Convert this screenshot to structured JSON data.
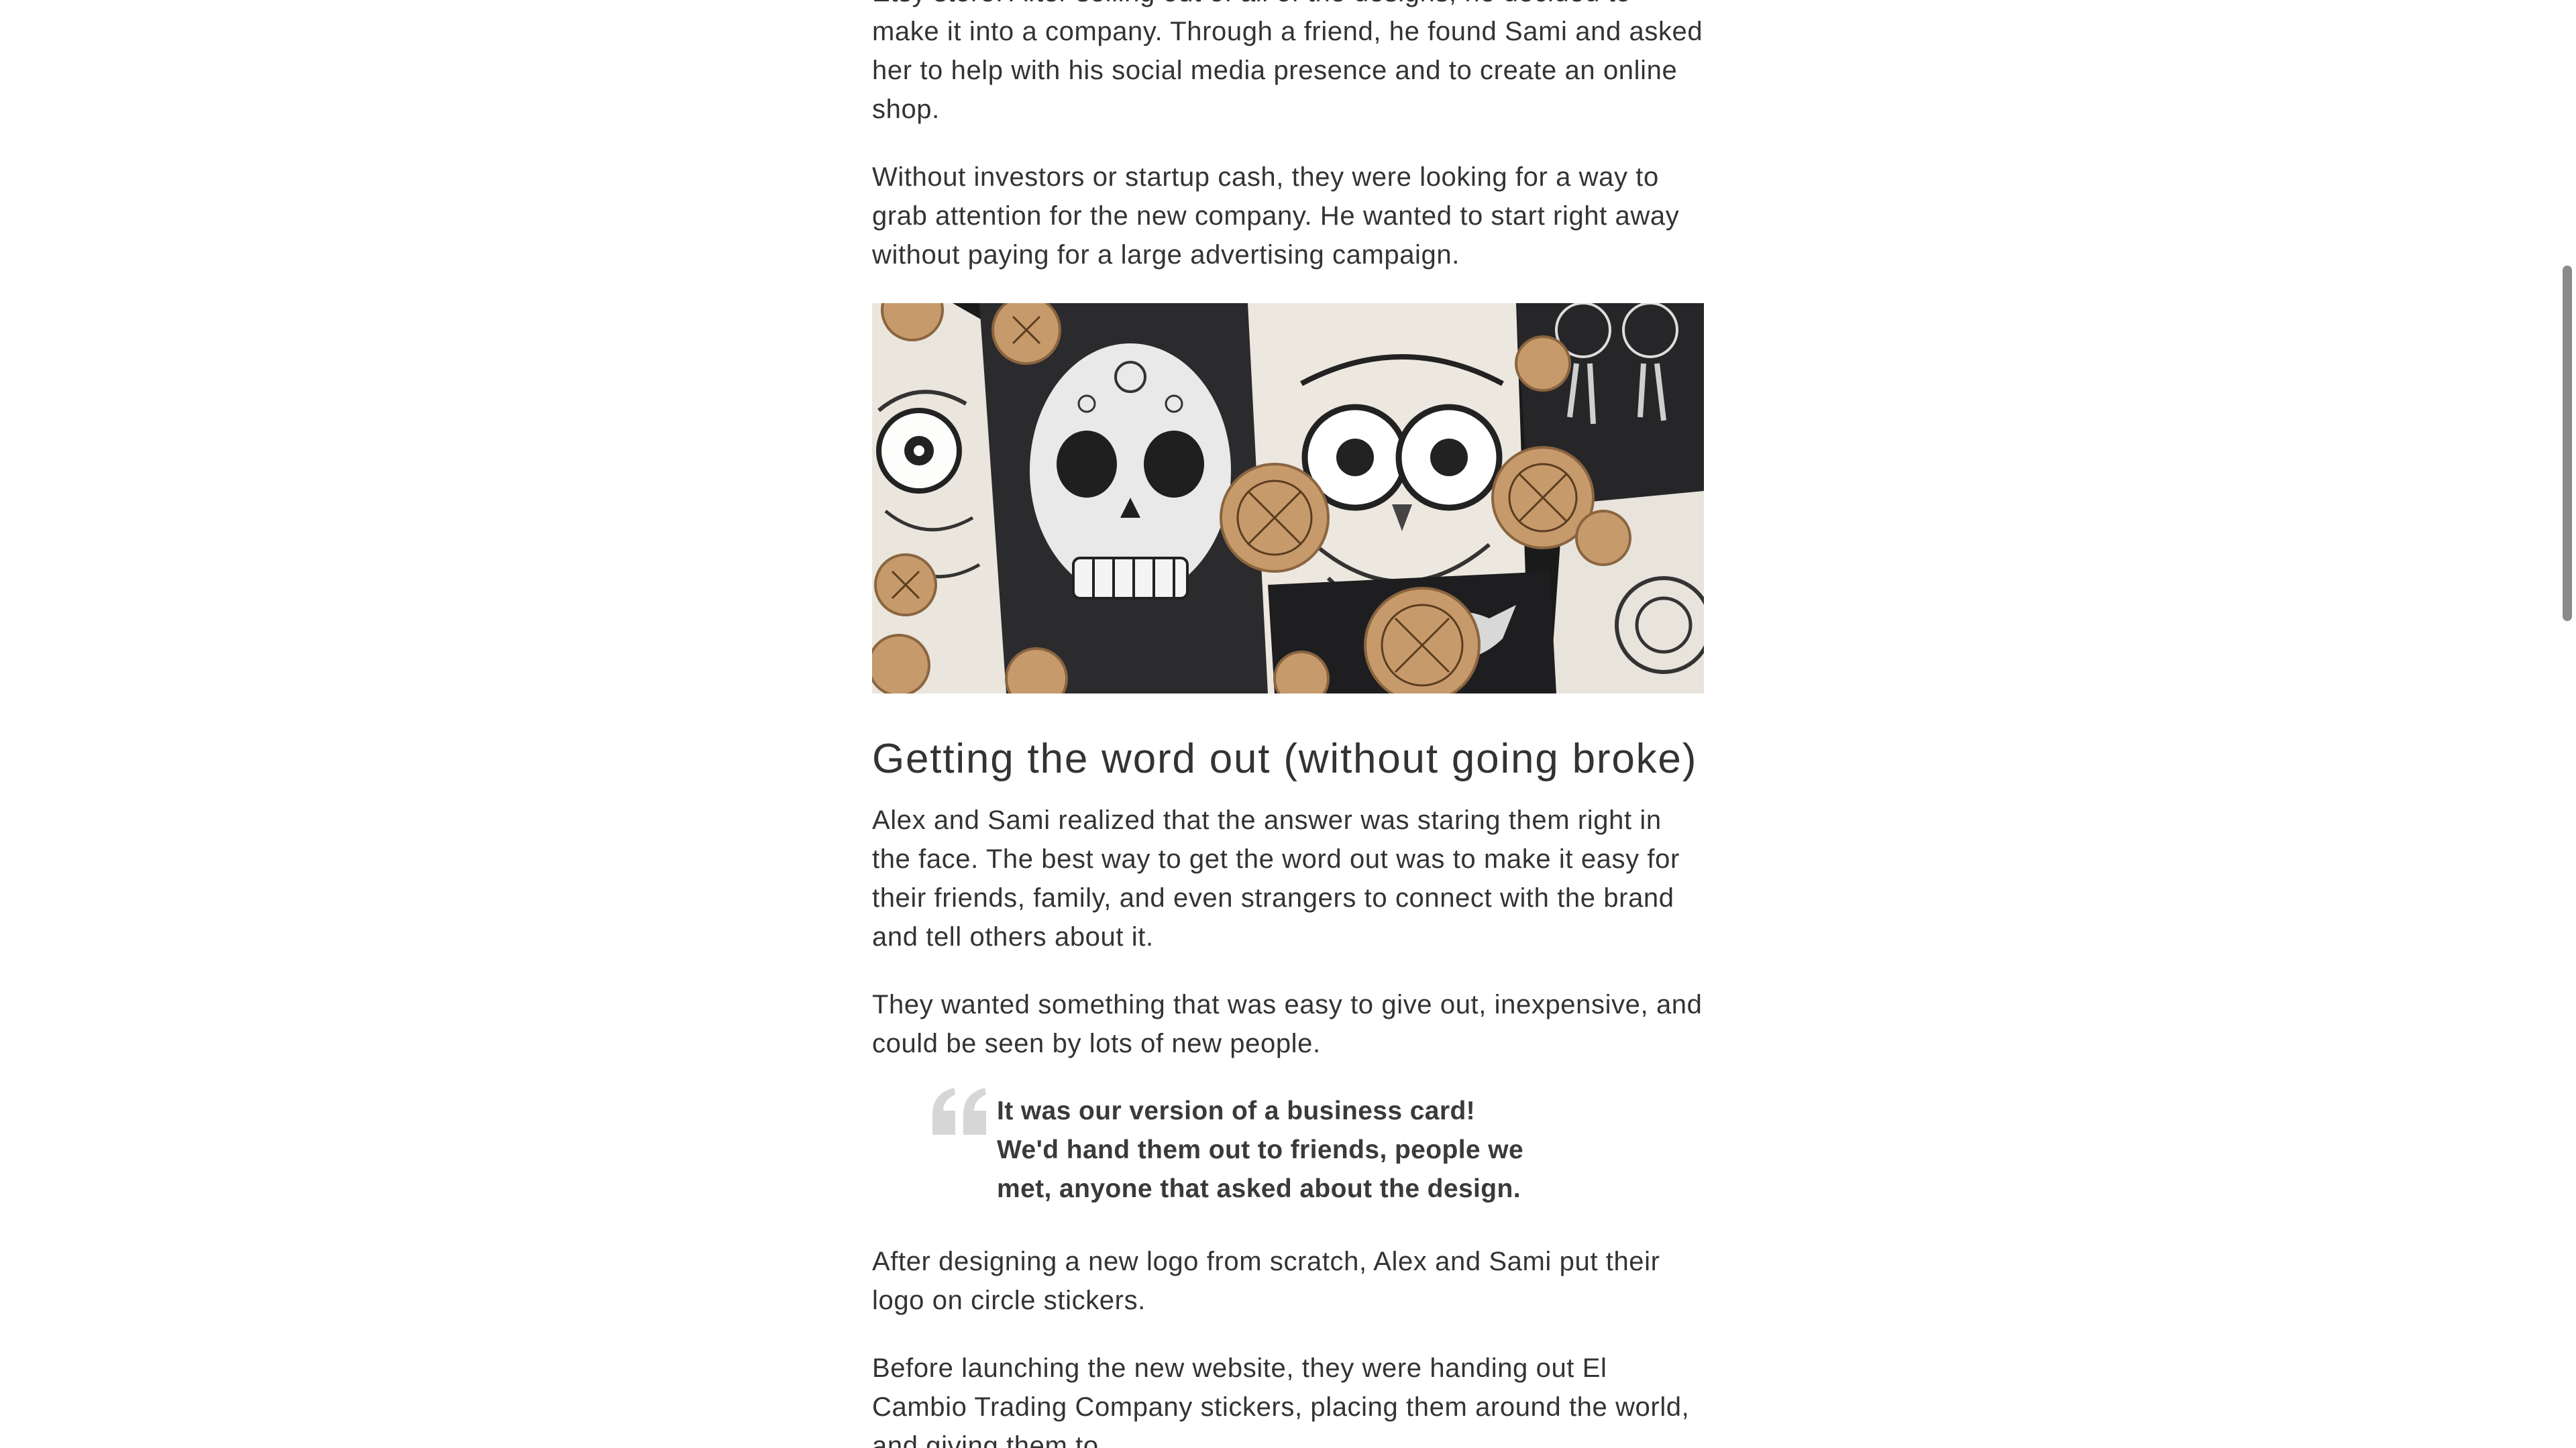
{
  "article": {
    "paragraphs_top": [
      "Alex began selling his hand-drawn designs and tanks through an Etsy store. After selling out of all of the designs, he decided to make it into a company. Through a friend, he found Sami and asked her to help with his social media presence and to create an online shop.",
      "Without investors or startup cash, they were looking for a way to grab attention for the new company. He wanted to start right away without paying for a large advertising campaign."
    ],
    "heading": "Getting the word out (without going broke)",
    "paragraphs_middle": [
      "Alex and Sami realized that the answer was staring them right in the face. The best way to get the word out was to make it easy for their friends, family, and even strangers to connect with the brand and tell others about it.",
      "They wanted something that was easy to give out, inexpensive, and could be seen by lots of new people."
    ],
    "quote": "It was our version of a business card! We'd hand them out to friends, people we met, anyone that asked about the design.",
    "paragraphs_bottom": [
      "After designing a new logo from scratch, Alex and Sami put their logo on circle stickers.",
      "Before launching the new website, they were handing out El Cambio Trading Company stickers, placing them around the world, and giving them to"
    ]
  },
  "icons": {
    "quote_mark": "quote-mark-icon"
  },
  "colors": {
    "text": "#333333",
    "heading": "#333333",
    "quote_mark": "#d6d6d6",
    "scroll_thumb": "#8a8a8a"
  }
}
